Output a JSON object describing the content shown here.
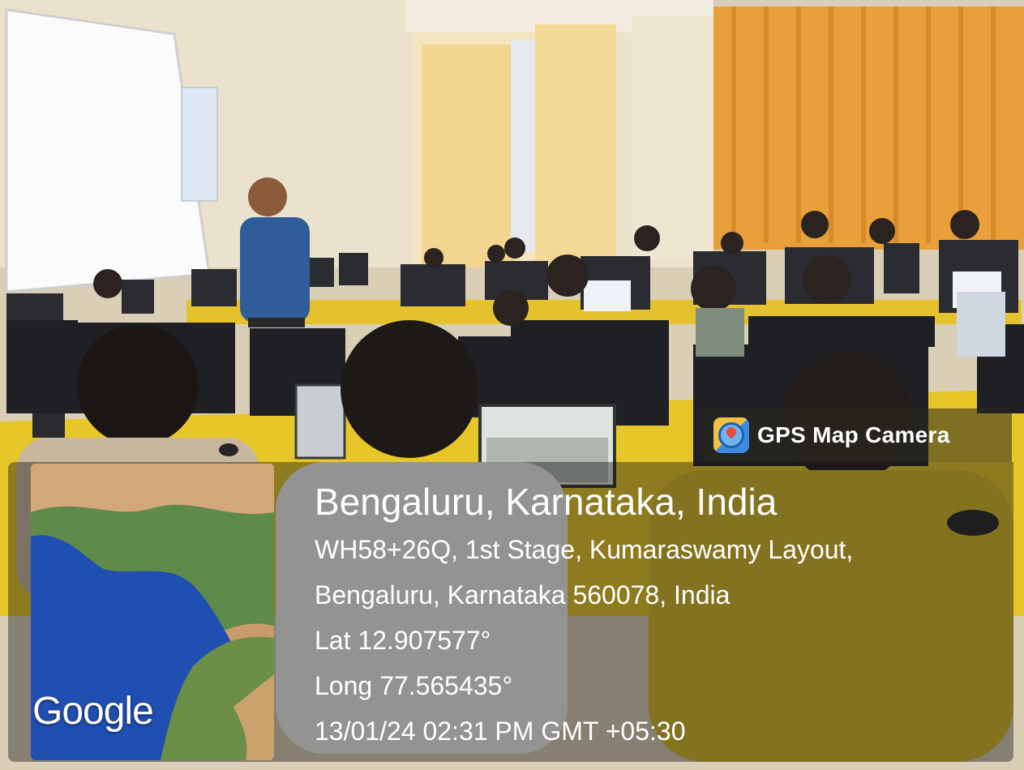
{
  "badge": {
    "label": "GPS Map Camera",
    "icon": "map-pin-icon"
  },
  "location": {
    "city": "Bengaluru, Karnataka, India",
    "address_line1": "WH58+26Q, 1st Stage, Kumaraswamy Layout,",
    "address_line2": "Bengaluru, Karnataka 560078, India",
    "latitude": "Lat 12.907577°",
    "longitude": "Long 77.565435°",
    "timestamp": "13/01/24 02:31 PM GMT +05:30"
  },
  "map": {
    "logo": "Google"
  },
  "colors": {
    "curtain": "#e9a03a",
    "desk": "#e7c629",
    "wall": "#eae2cc"
  }
}
